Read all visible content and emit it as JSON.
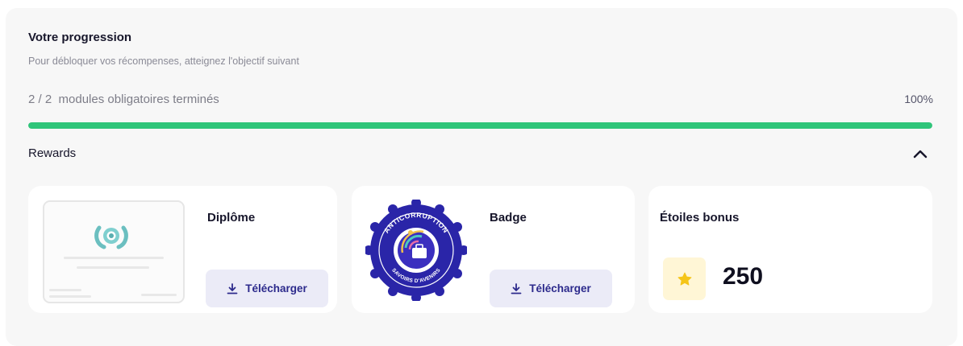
{
  "progress": {
    "title": "Votre progression",
    "subtitle": "Pour débloquer vos récompenses, atteignez l'objectif suivant",
    "label": "2 / 2  modules obligatoires terminés",
    "percent_text": "100%",
    "fraction": 1.0,
    "color": "#2fc57a"
  },
  "rewards": {
    "label": "Rewards",
    "toggle_icon": "chevron-up-icon",
    "cards": {
      "diplome": {
        "title": "Diplôme",
        "button_label": "Télécharger",
        "button_icon": "download-icon",
        "thumbnail": "diploma-preview"
      },
      "badge": {
        "title": "Badge",
        "button_label": "Télécharger",
        "button_icon": "download-icon",
        "badge_top_text": "ANTICORRUPTION",
        "badge_bottom_text": "SAVOIRS D'AVENIRS"
      },
      "stars": {
        "title": "Étoiles bonus",
        "value": "250",
        "icon": "star-icon"
      }
    }
  },
  "colors": {
    "accent": "#2c2a8c",
    "button_bg": "#ebebf7",
    "progress": "#2fc57a",
    "star": "#f5c518",
    "badge_border": "#2a25a8"
  }
}
